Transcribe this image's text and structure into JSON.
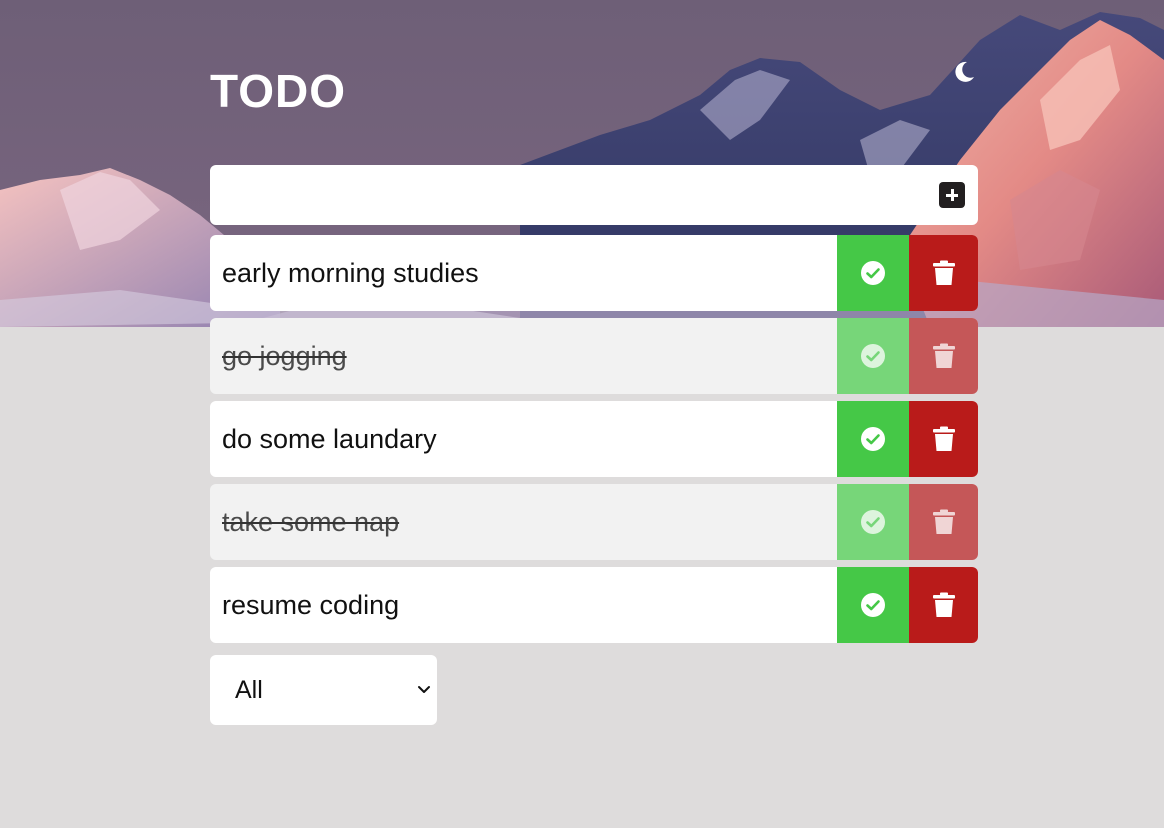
{
  "app": {
    "title": "TODO",
    "theme_toggle_icon": "moon-icon"
  },
  "new_todo": {
    "value": "",
    "placeholder": "",
    "add_icon": "plus-icon"
  },
  "todos": [
    {
      "text": "early morning studies",
      "completed": false
    },
    {
      "text": "go jogging",
      "completed": true
    },
    {
      "text": "do some laundary",
      "completed": false
    },
    {
      "text": "take some nap",
      "completed": true
    },
    {
      "text": "resume coding",
      "completed": false
    }
  ],
  "actions": {
    "complete_icon": "check-circle-icon",
    "delete_icon": "trash-icon"
  },
  "filter": {
    "selected": "All",
    "icon": "chevron-down-icon"
  },
  "colors": {
    "page_background": "#dedcdc",
    "complete": "#45c847",
    "delete": "#b91b1a",
    "add_button": "#221f20"
  }
}
